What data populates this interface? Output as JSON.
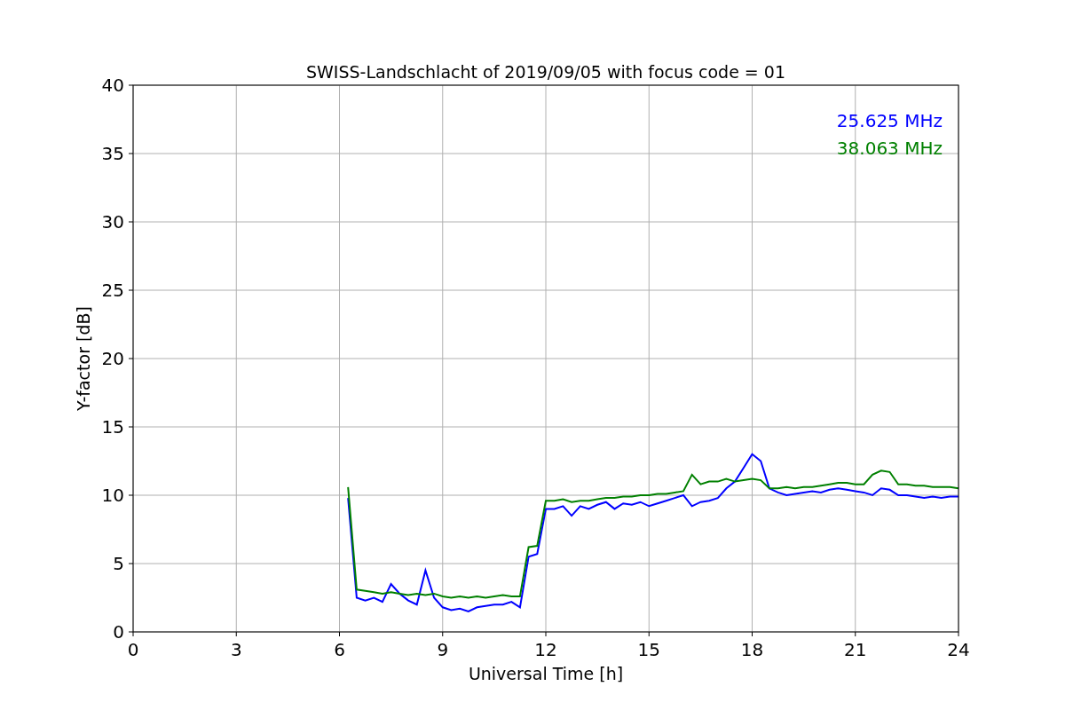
{
  "figure": {
    "chart_data": {
      "type": "line",
      "title": "SWISS-Landschlacht of 2019/09/05 with focus code = 01",
      "xlabel": "Universal Time [h]",
      "ylabel": "Y-factor [dB]",
      "x": [
        6.25,
        6.5,
        6.75,
        7,
        7.25,
        7.5,
        7.75,
        8,
        8.25,
        8.5,
        8.75,
        9,
        9.25,
        9.5,
        9.75,
        10,
        10.25,
        10.5,
        10.75,
        11,
        11.25,
        11.5,
        11.75,
        12,
        12.25,
        12.5,
        12.75,
        13,
        13.25,
        13.5,
        13.75,
        14,
        14.25,
        14.5,
        14.75,
        15,
        15.25,
        15.5,
        15.75,
        16,
        16.25,
        16.5,
        16.75,
        17,
        17.25,
        17.5,
        17.75,
        18,
        18.25,
        18.5,
        18.75,
        19,
        19.25,
        19.5,
        19.75,
        20,
        20.25,
        20.5,
        20.75,
        21,
        21.25,
        21.5,
        21.75,
        22,
        22.25,
        22.5,
        22.75,
        23,
        23.25,
        23.5,
        23.75,
        24
      ],
      "series": [
        {
          "name": "25.625 MHz",
          "color": "#0000ff",
          "values": [
            9.8,
            2.5,
            2.3,
            2.5,
            2.2,
            3.5,
            2.8,
            2.3,
            2.0,
            4.5,
            2.5,
            1.8,
            1.6,
            1.7,
            1.5,
            1.8,
            1.9,
            2.0,
            2.0,
            2.2,
            1.8,
            5.5,
            5.7,
            9.0,
            9.0,
            9.2,
            8.5,
            9.2,
            9.0,
            9.3,
            9.5,
            9.0,
            9.4,
            9.3,
            9.5,
            9.2,
            9.4,
            9.6,
            9.8,
            10.0,
            9.2,
            9.5,
            9.6,
            9.8,
            10.5,
            11.0,
            12.0,
            13.0,
            12.5,
            10.5,
            10.2,
            10.0,
            10.1,
            10.2,
            10.3,
            10.2,
            10.4,
            10.5,
            10.4,
            10.3,
            10.2,
            10.0,
            10.5,
            10.4,
            10.0,
            10.0,
            9.9,
            9.8,
            9.9,
            9.8,
            9.9,
            9.9
          ]
        },
        {
          "name": "38.063 MHz",
          "color": "#008000",
          "values": [
            10.6,
            3.1,
            3.0,
            2.9,
            2.8,
            2.9,
            2.8,
            2.7,
            2.8,
            2.7,
            2.8,
            2.6,
            2.5,
            2.6,
            2.5,
            2.6,
            2.5,
            2.6,
            2.7,
            2.6,
            2.6,
            6.2,
            6.3,
            9.6,
            9.6,
            9.7,
            9.5,
            9.6,
            9.6,
            9.7,
            9.8,
            9.8,
            9.9,
            9.9,
            10.0,
            10.0,
            10.1,
            10.1,
            10.2,
            10.3,
            11.5,
            10.8,
            11.0,
            11.0,
            11.2,
            11.0,
            11.1,
            11.2,
            11.1,
            10.5,
            10.5,
            10.6,
            10.5,
            10.6,
            10.6,
            10.7,
            10.8,
            10.9,
            10.9,
            10.8,
            10.8,
            11.5,
            11.8,
            11.7,
            10.8,
            10.8,
            10.7,
            10.7,
            10.6,
            10.6,
            10.6,
            10.5
          ]
        }
      ],
      "grid": true,
      "xlim": [
        0,
        24
      ],
      "ylim": [
        0,
        40
      ],
      "xticks": [
        0,
        3,
        6,
        9,
        12,
        15,
        18,
        21,
        24
      ],
      "yticks": [
        0,
        5,
        10,
        15,
        20,
        25,
        30,
        35,
        40
      ]
    }
  }
}
